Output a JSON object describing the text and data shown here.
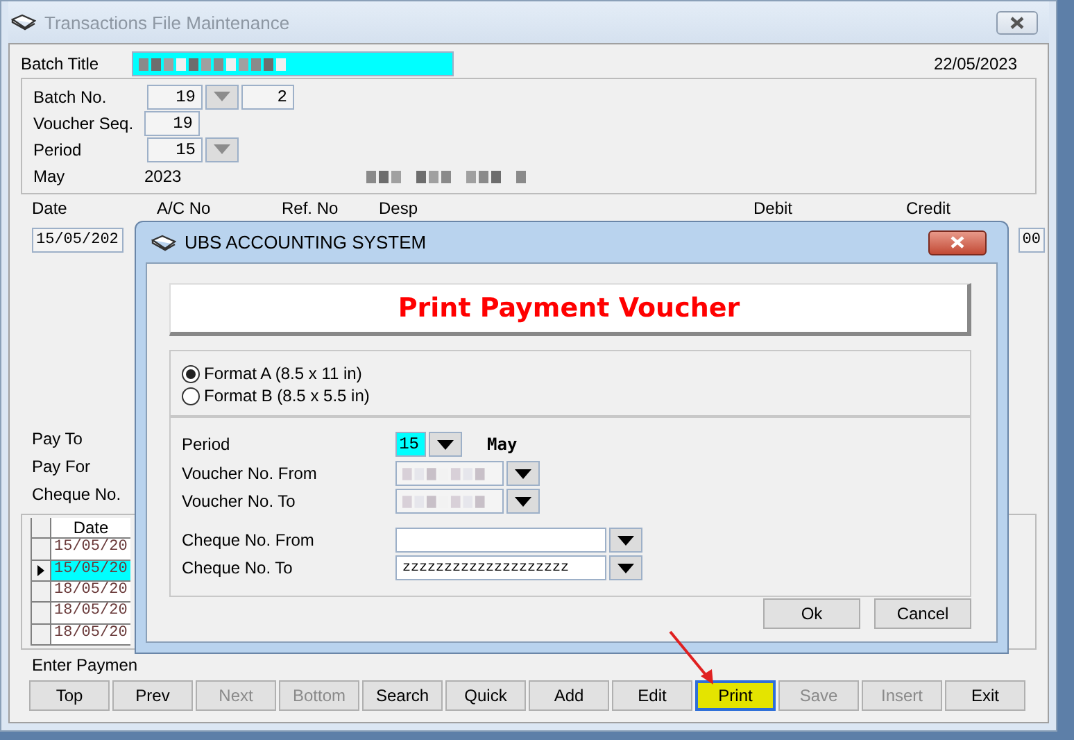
{
  "window": {
    "title": "Transactions File Maintenance"
  },
  "header": {
    "batch_title_label": "Batch Title",
    "date": "22/05/2023"
  },
  "batch": {
    "batch_no_label": "Batch No.",
    "batch_no": "19",
    "batch_sub": "2",
    "voucher_seq_label": "Voucher Seq.",
    "voucher_seq": "19",
    "period_label": "Period",
    "period": "15",
    "month": "May",
    "year": "2023"
  },
  "entry_columns": [
    "Date",
    "A/C No",
    "Ref. No",
    "Desp",
    "Debit",
    "Credit"
  ],
  "entry": {
    "date": "15/05/202",
    "credit": "00"
  },
  "payment_labels": [
    "Pay To",
    "Pay For",
    "Cheque No."
  ],
  "grid": {
    "columns": [
      "Date"
    ],
    "rows": [
      {
        "date": "15/05/20",
        "selected": false
      },
      {
        "date": "15/05/20",
        "selected": true
      },
      {
        "date": "18/05/20",
        "selected": false
      },
      {
        "date": "18/05/20",
        "selected": false
      },
      {
        "date": "18/05/20",
        "selected": false
      }
    ]
  },
  "hint": "Enter Paymen",
  "buttons": [
    {
      "label": "Top",
      "disabled": false,
      "highlighted": false
    },
    {
      "label": "Prev",
      "disabled": false,
      "highlighted": false
    },
    {
      "label": "Next",
      "disabled": true,
      "highlighted": false
    },
    {
      "label": "Bottom",
      "disabled": true,
      "highlighted": false
    },
    {
      "label": "Search",
      "disabled": false,
      "highlighted": false
    },
    {
      "label": "Quick",
      "disabled": false,
      "highlighted": false
    },
    {
      "label": "Add",
      "disabled": false,
      "highlighted": false
    },
    {
      "label": "Edit",
      "disabled": false,
      "highlighted": false
    },
    {
      "label": "Print",
      "disabled": false,
      "highlighted": true
    },
    {
      "label": "Save",
      "disabled": true,
      "highlighted": false
    },
    {
      "label": "Insert",
      "disabled": true,
      "highlighted": false
    },
    {
      "label": "Exit",
      "disabled": false,
      "highlighted": false
    }
  ],
  "dialog": {
    "title": "UBS ACCOUNTING SYSTEM",
    "heading": "Print Payment Voucher",
    "formats": [
      {
        "label": "Format A (8.5 x 11 in)",
        "selected": true
      },
      {
        "label": "Format B (8.5 x 5.5 in)",
        "selected": false
      }
    ],
    "period": {
      "label": "Period",
      "value": "15",
      "month": "May"
    },
    "voucher_from": {
      "label": "Voucher No. From"
    },
    "voucher_to": {
      "label": "Voucher No. To"
    },
    "cheque_from": {
      "label": "Cheque No. From"
    },
    "cheque_to": {
      "label": "Cheque No. To",
      "value": "zzzzzzzzzzzzzzzzzzzz"
    },
    "buttons": [
      "Ok",
      "Cancel"
    ]
  }
}
